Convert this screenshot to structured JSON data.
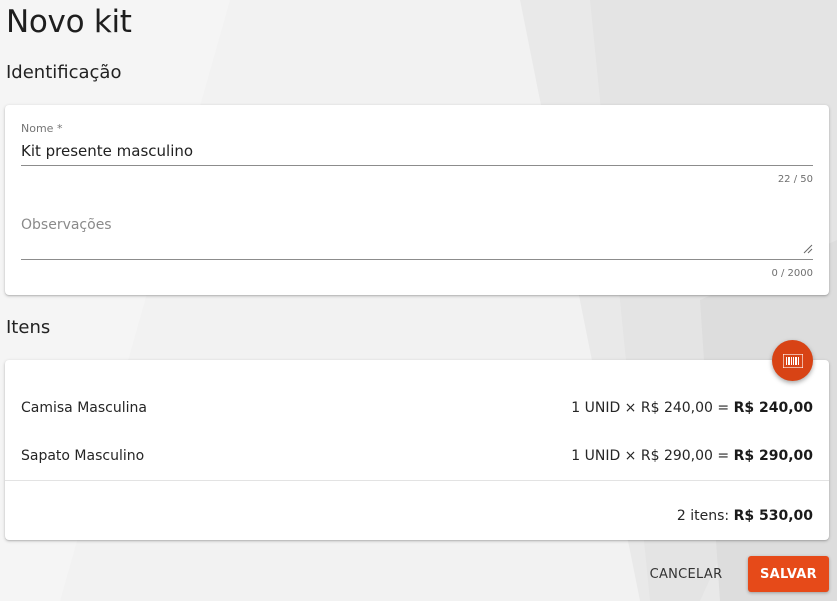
{
  "page": {
    "title": "Novo kit"
  },
  "identification": {
    "section_title": "Identificação",
    "name_field": {
      "label": "Nome *",
      "value": "Kit presente masculino",
      "counter": "22 / 50"
    },
    "notes_field": {
      "placeholder": "Observações",
      "counter": "0 / 2000"
    }
  },
  "items_section": {
    "section_title": "Itens",
    "barcode_button_icon": "barcode-icon",
    "items": [
      {
        "name": "Camisa Masculina",
        "calc": "1 UNID × R$ 240,00 = ",
        "subtotal": "R$ 240,00"
      },
      {
        "name": "Sapato Masculino",
        "calc": "1 UNID × R$ 290,00 = ",
        "subtotal": "R$ 290,00"
      }
    ],
    "total_label": "2 itens: ",
    "total_value": "R$ 530,00"
  },
  "actions": {
    "cancel_label": "CANCELAR",
    "save_label": "SALVAR"
  },
  "colors": {
    "accent": "#e64a19",
    "fab": "#d84315"
  }
}
